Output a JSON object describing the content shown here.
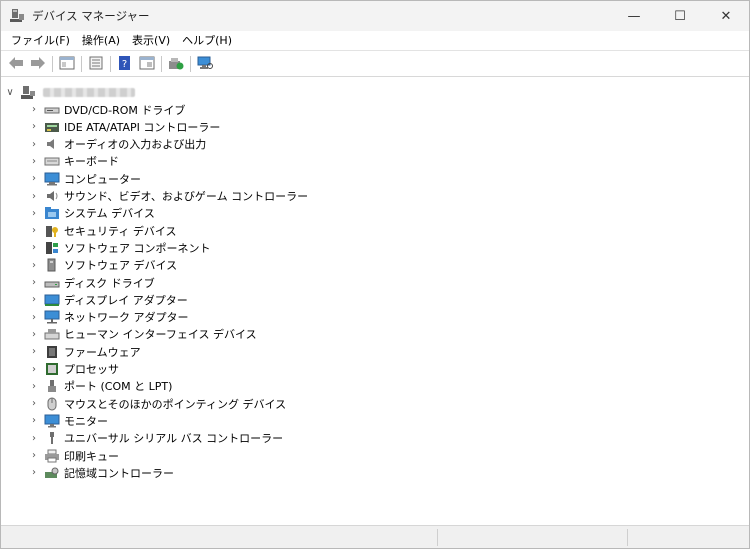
{
  "window": {
    "title": "デバイス マネージャー",
    "controls": {
      "minimize": "—",
      "maximize": "☐",
      "close": "✕"
    }
  },
  "menu": {
    "items": [
      "ファイル(F)",
      "操作(A)",
      "表示(V)",
      "ヘルプ(H)"
    ]
  },
  "toolbar": {
    "buttons": [
      "back-arrow-icon",
      "forward-arrow-icon",
      "properties-pane-icon",
      "device-list-icon",
      "help-icon",
      "show-hidden-icon",
      "update-driver-icon",
      "scan-hardware-icon"
    ]
  },
  "tree": {
    "root_expander": "∨",
    "collapsed_glyph": "›",
    "categories": [
      {
        "label": "DVD/CD-ROM ドライブ",
        "icon": "dvd-drive-icon"
      },
      {
        "label": "IDE ATA/ATAPI コントローラー",
        "icon": "ide-controller-icon"
      },
      {
        "label": "オーディオの入力および出力",
        "icon": "speaker-icon"
      },
      {
        "label": "キーボード",
        "icon": "keyboard-icon"
      },
      {
        "label": "コンピューター",
        "icon": "computer-icon"
      },
      {
        "label": "サウンド、ビデオ、およびゲーム コントローラー",
        "icon": "sound-icon"
      },
      {
        "label": "システム デバイス",
        "icon": "system-folder-icon"
      },
      {
        "label": "セキュリティ デバイス",
        "icon": "security-key-icon"
      },
      {
        "label": "ソフトウェア コンポーネント",
        "icon": "software-component-icon"
      },
      {
        "label": "ソフトウェア デバイス",
        "icon": "software-device-icon"
      },
      {
        "label": "ディスク ドライブ",
        "icon": "disk-drive-icon"
      },
      {
        "label": "ディスプレイ アダプター",
        "icon": "display-adapter-icon"
      },
      {
        "label": "ネットワーク アダプター",
        "icon": "network-adapter-icon"
      },
      {
        "label": "ヒューマン インターフェイス デバイス",
        "icon": "hid-icon"
      },
      {
        "label": "ファームウェア",
        "icon": "firmware-icon"
      },
      {
        "label": "プロセッサ",
        "icon": "processor-icon"
      },
      {
        "label": "ポート (COM と LPT)",
        "icon": "port-icon"
      },
      {
        "label": "マウスとそのほかのポインティング デバイス",
        "icon": "mouse-icon"
      },
      {
        "label": "モニター",
        "icon": "monitor-icon"
      },
      {
        "label": "ユニバーサル シリアル バス コントローラー",
        "icon": "usb-icon"
      },
      {
        "label": "印刷キュー",
        "icon": "printer-icon"
      },
      {
        "label": "記憶域コントローラー",
        "icon": "storage-controller-icon"
      }
    ]
  }
}
